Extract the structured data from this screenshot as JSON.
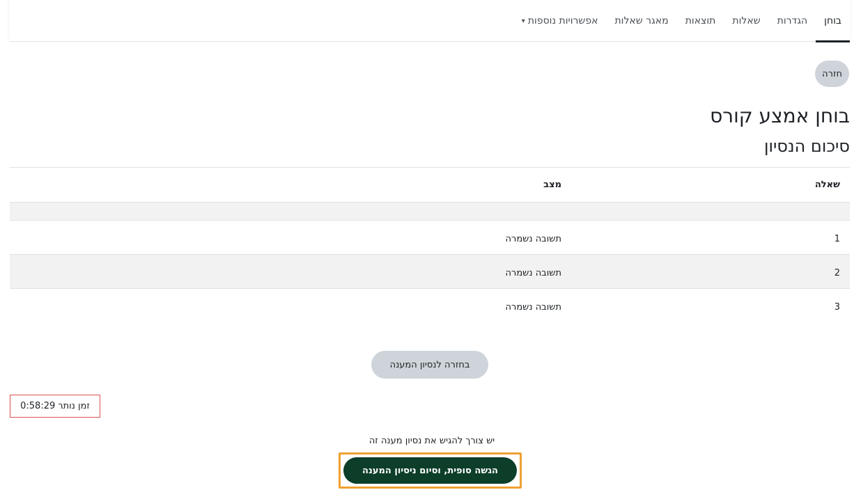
{
  "nav": {
    "tabs": [
      {
        "label": "בוחן",
        "active": true
      },
      {
        "label": "הגדרות",
        "active": false
      },
      {
        "label": "שאלות",
        "active": false
      },
      {
        "label": "תוצאות",
        "active": false
      },
      {
        "label": "מאגר שאלות",
        "active": false
      },
      {
        "label": "אפשרויות נוספות",
        "active": false
      }
    ]
  },
  "back_label": "חזרה",
  "quiz_title": "בוחן אמצע קורס",
  "section_title": "סיכום הנסיון",
  "table": {
    "headers": {
      "question": "שאלה",
      "status": "מצב"
    },
    "rows": [
      {
        "question": "1",
        "status": "תשובה נשמרה"
      },
      {
        "question": "2",
        "status": "תשובה נשמרה"
      },
      {
        "question": "3",
        "status": "תשובה נשמרה"
      }
    ]
  },
  "return_label": "בחזרה לנסיון המענה",
  "timer": {
    "label": "זמן נותר",
    "value": "0:58:29"
  },
  "notice": "יש צורך להגיש את נסיון מענה זה",
  "submit_label": "הגשה סופית, וסיום ניסיון המענה",
  "colors": {
    "submit_bg": "#0c3e2a",
    "highlight_border": "#f0a030",
    "timer_border": "#d9534f"
  }
}
